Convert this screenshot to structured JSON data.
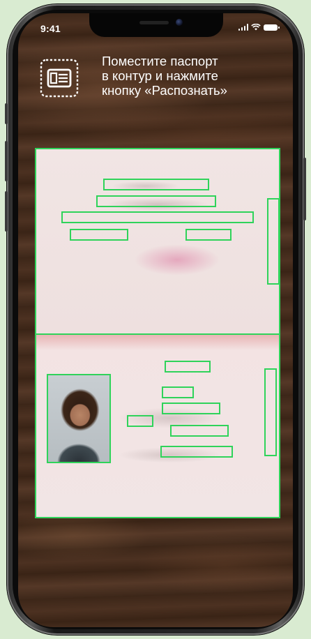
{
  "status_bar": {
    "time": "9:41",
    "icons": [
      "signal-icon",
      "wifi-icon",
      "battery-icon"
    ]
  },
  "instruction": {
    "icon": "passport-scan-icon",
    "lines": [
      "Поместите паспорт",
      "в контур и нажмите",
      "кнопку «Распознать»"
    ]
  },
  "colors": {
    "frame_accent": "#2fd35a",
    "background": "#d9ebd1",
    "text": "#ffffff"
  }
}
